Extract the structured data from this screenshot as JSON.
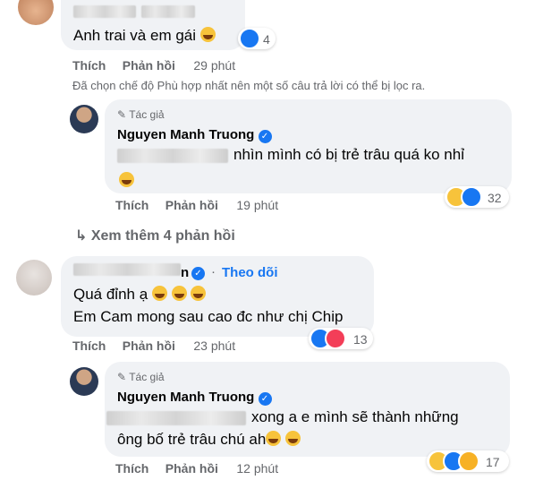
{
  "comment1": {
    "text": "Anh trai và em gái",
    "reaction_count": "4",
    "like_label": "Thích",
    "reply_label": "Phản hồi",
    "time": "29 phút"
  },
  "filter_notice": "Đã chọn chế độ Phù hợp nhất nên một số câu trả lời có thể bị lọc ra.",
  "reply1": {
    "author_badge": "Tác giả",
    "name": "Nguyen Manh Truong",
    "text": "nhìn mình có bị trẻ trâu quá ko nhỉ",
    "reaction_count": "32",
    "like_label": "Thích",
    "reply_label": "Phản hồi",
    "time": "19 phút"
  },
  "see_more": "Xem thêm 4 phản hồi",
  "comment2": {
    "name_suffix": "n",
    "follow_label": "Theo dõi",
    "line1": "Quá đỉnh ạ",
    "line2": "Em Cam mong sau cao đc như chị Chip",
    "reaction_count": "13",
    "like_label": "Thích",
    "reply_label": "Phản hồi",
    "time": "23 phút"
  },
  "reply2": {
    "author_badge": "Tác giả",
    "name": "Nguyen Manh Truong",
    "line1": "xong a e mình sẽ thành những",
    "line2": "ông bố trẻ trâu chú ah",
    "reaction_count": "17",
    "like_label": "Thích",
    "reply_label": "Phản hồi",
    "time": "12 phút"
  },
  "colors": {
    "bubble": "#f0f2f5",
    "accent": "#1877f2",
    "muted": "#65676b"
  }
}
